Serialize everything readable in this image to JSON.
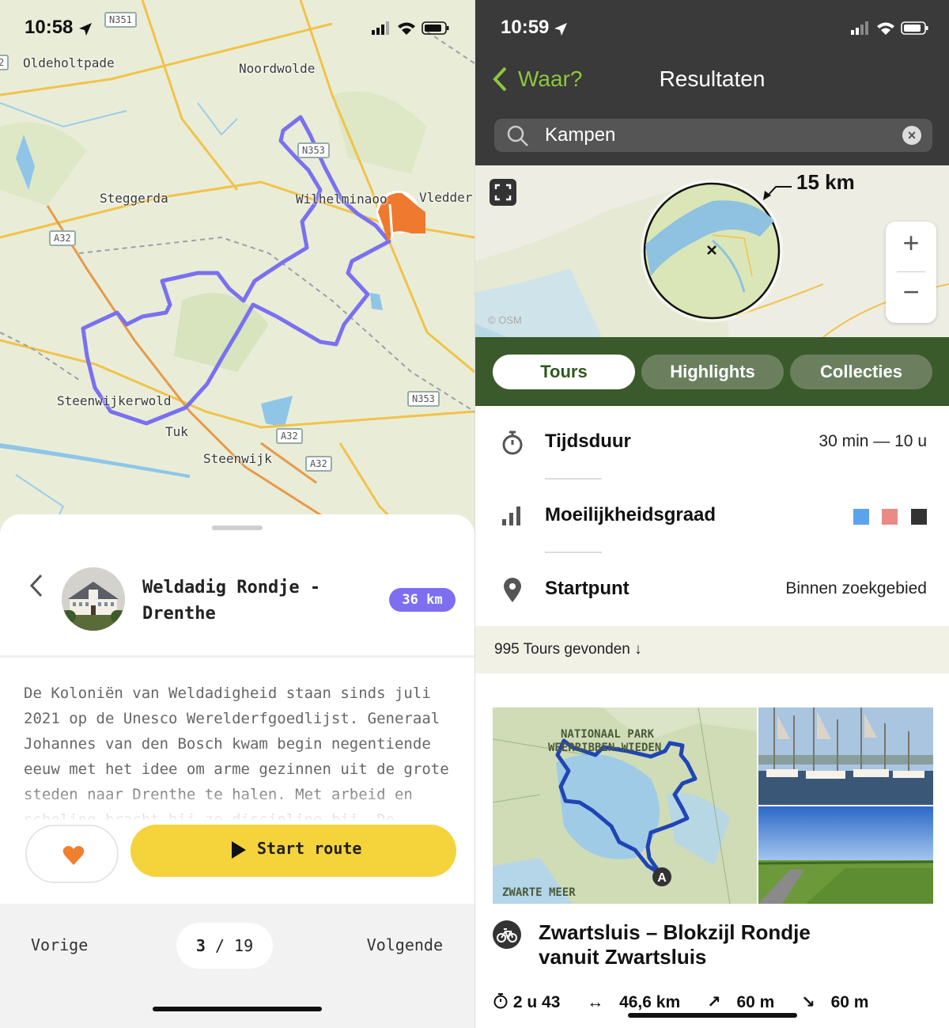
{
  "left": {
    "status_time": "10:58",
    "map": {
      "places": [
        "Oldeholtpade",
        "Noordwolde",
        "Steggerda",
        "Wilhelminaoo",
        "Vledder",
        "Steenwijkerwold",
        "Tuk",
        "Steenwijk"
      ],
      "roads": [
        "N351",
        "N353",
        "A32",
        "A32",
        "N353",
        "A32",
        "A32"
      ],
      "edge_road": "2"
    },
    "tour": {
      "title": "Weldadig Rondje - Drenthe",
      "distance": "36 km",
      "description": "De Koloniën van Weldadigheid staan sinds juli 2021 op de Unesco Werelderfgoedlijst. Generaal Johannes van den Bosch kwam begin negentiende eeuw met het idee om arme gezinnen uit de grote steden naar Drenthe te halen. Met arbeid en scholing bracht hij ze discipline bij. De fietsroute"
    },
    "start_button": "Start route",
    "pager": {
      "prev": "Vorige",
      "current": "3",
      "separator": "/",
      "total": "19",
      "next": "Volgende"
    }
  },
  "right": {
    "status_time": "10:59",
    "nav": {
      "back": "Waar?",
      "title": "Resultaten"
    },
    "search": {
      "value": "Kampen"
    },
    "map": {
      "radius_label": "15 km",
      "attribution": "© OSM"
    },
    "tabs": [
      "Tours",
      "Highlights",
      "Collecties"
    ],
    "active_tab": "Tours",
    "filters": [
      {
        "label": "Tijdsduur",
        "value": "30 min — 10 u",
        "icon": "stopwatch-icon"
      },
      {
        "label": "Moeilijkheidsgraad",
        "value": "",
        "icon": "signal-bars-icon",
        "colors": [
          "#5ba4ec",
          "#e98a86",
          "#333333"
        ]
      },
      {
        "label": "Startpunt",
        "value": "Binnen zoekgebied",
        "icon": "location-pin-icon"
      }
    ],
    "results_text": "995 Tours gevonden ↓",
    "card": {
      "map_labels": [
        "NATIONAAL PARK",
        "WEERRIBBEN-WIEDEN",
        "ZWARTE MEER"
      ],
      "start_marker": "A",
      "title": "Zwartsluis – Blokzijl Rondje vanuit Zwartsluis",
      "duration": "2 u 43",
      "distance": "46,6 km",
      "ascent": "60 m",
      "descent": "60 m"
    }
  }
}
